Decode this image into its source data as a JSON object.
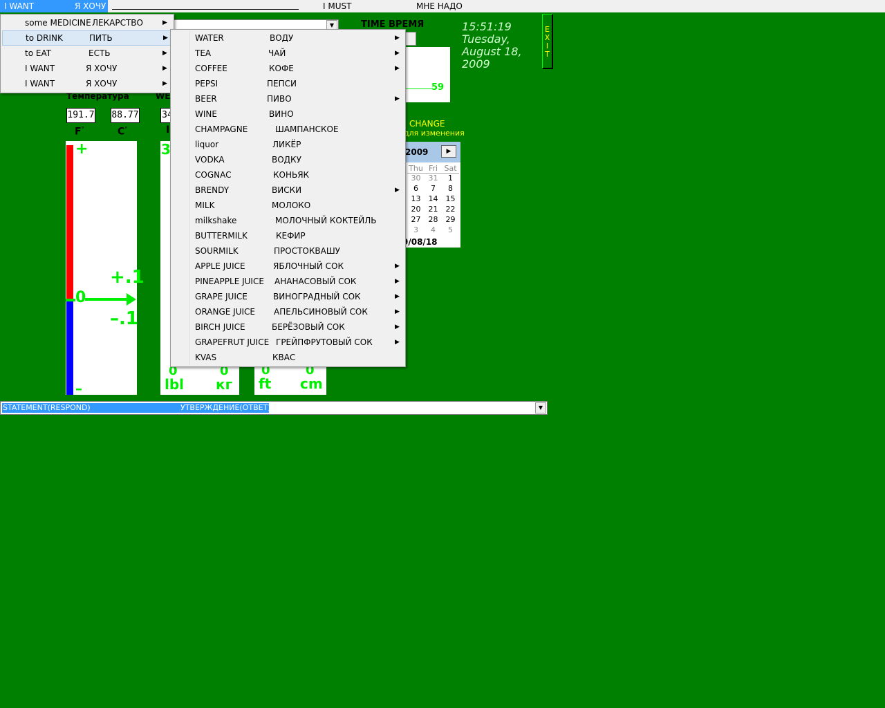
{
  "menubar": {
    "active_en": "I WANT",
    "active_ru": "Я ХОЧУ",
    "must_en": "I MUST",
    "must_ru": "МНЕ НАДО"
  },
  "main_menu": [
    {
      "en": "some MEDICINE",
      "ru": "ЛЕКАРСТВО",
      "submenu": true
    },
    {
      "en": "to DRINK",
      "ru": "ПИТЬ",
      "submenu": true,
      "highlighted": true
    },
    {
      "en": "to EAT",
      "ru": "ЕСТЬ",
      "submenu": true
    },
    {
      "en": "I WANT",
      "ru": "Я ХОЧУ",
      "submenu": true
    },
    {
      "en": "I WANT",
      "ru": "Я ХОЧУ",
      "submenu": true
    }
  ],
  "drink_menu": [
    {
      "en": "WATER",
      "ru": "ВОДУ",
      "submenu": true
    },
    {
      "en": "TEA",
      "ru": "ЧАЙ",
      "submenu": true
    },
    {
      "en": "COFFEE",
      "ru": "КОФЕ",
      "submenu": true
    },
    {
      "en": "PEPSI",
      "ru": "ПЕПСИ",
      "submenu": false
    },
    {
      "en": "BEER",
      "ru": "ПИВО",
      "submenu": true
    },
    {
      "en": "WINE",
      "ru": "ВИНО",
      "submenu": false
    },
    {
      "en": "CHAMPAGNE",
      "ru": "ШАМПАНСКОЕ",
      "submenu": false
    },
    {
      "en": "liquor",
      "ru": "ЛИКЁР",
      "submenu": false
    },
    {
      "en": "VODKA",
      "ru": "ВОДКУ",
      "submenu": false
    },
    {
      "en": "COGNAC",
      "ru": "КОНЬЯК",
      "submenu": false
    },
    {
      "en": "BRENDY",
      "ru": "ВИСКИ",
      "submenu": true
    },
    {
      "en": "MILK",
      "ru": "МОЛОКО",
      "submenu": false
    },
    {
      "en": "milkshake",
      "ru": "МОЛОЧНЫЙ КОКТЕЙЛЬ",
      "submenu": false
    },
    {
      "en": "BUTTERMILK",
      "ru": "КЕФИР",
      "submenu": false
    },
    {
      "en": "SOURMILK",
      "ru": "ПРОСТОКВАШУ",
      "submenu": false
    },
    {
      "en": "APPLE JUICE",
      "ru": "ЯБЛОЧНЫЙ СОК",
      "submenu": true
    },
    {
      "en": "PINEAPPLE JUICE",
      "ru": "АНАНАСОВЫЙ СОК",
      "submenu": true
    },
    {
      "en": "GRAPE JUICE",
      "ru": "ВИНОГРАДНЫЙ СОК",
      "submenu": true
    },
    {
      "en": "ORANGE JUICE",
      "ru": "АПЕЛЬСИНОВЫЙ СОК",
      "submenu": true
    },
    {
      "en": "BIRCH   JUICE",
      "ru": "БЕРЁЗОВЫЙ СОК",
      "submenu": true
    },
    {
      "en": "GRAPEFRUT  JUICE",
      "ru": "ГРЕЙПФРУТОВЫЙ СОК",
      "submenu": true
    },
    {
      "en": "KVAS",
      "ru": "КВАС",
      "submenu": false
    }
  ],
  "time": {
    "label": "TIME  ВРЕМЯ",
    "gauge_value": "59",
    "clock_time": "15:51:19",
    "clock_day": "Tuesday,",
    "clock_date": "August 18,",
    "clock_year": "2009"
  },
  "change_note": {
    "line1": "CHANGE",
    "line2": "для изменения"
  },
  "thermometer": {
    "title": "Температура",
    "f_value": "191.7",
    "c_value": "88.77",
    "f_unit": "F",
    "c_unit": "C",
    "degree": "°",
    "plus": "+",
    "minus": "–",
    "plus_one": "+.1",
    "minus_one": "–.1",
    "zero": "0"
  },
  "weight": {
    "title_fragment": "WE",
    "value_fragment": "34",
    "unit_fragment": "I",
    "scale_top": "3",
    "lbl_value": "0",
    "kg_value": "0",
    "lbl_unit": "lbl",
    "kg_unit": "кг"
  },
  "height": {
    "ft_value": "0",
    "cm_value": "0",
    "ft_unit": "ft",
    "cm_unit": "cm"
  },
  "calendar": {
    "year": "2009",
    "weekdays": [
      "Thu",
      "Fri",
      "Sat"
    ],
    "rows": [
      [
        "30",
        "31",
        "1"
      ],
      [
        "6",
        "7",
        "8"
      ],
      [
        "13",
        "14",
        "15"
      ],
      [
        "20",
        "21",
        "22"
      ],
      [
        "27",
        "28",
        "29"
      ],
      [
        "3",
        "4",
        "5"
      ]
    ],
    "today": "9/08/18"
  },
  "exit": {
    "letters": [
      "E",
      "X",
      "I",
      "T"
    ]
  },
  "status_bar": {
    "en": "STATEMENT(RESPOND)",
    "ru": "УТВЕРЖДЕНИЕ(ОТВЕТ)"
  },
  "colors": {
    "background": "#008000",
    "highlight": "#3399ff",
    "gauge_green": "#00ee00",
    "thermo_red": "#ff0000",
    "thermo_blue": "#0000ff"
  }
}
